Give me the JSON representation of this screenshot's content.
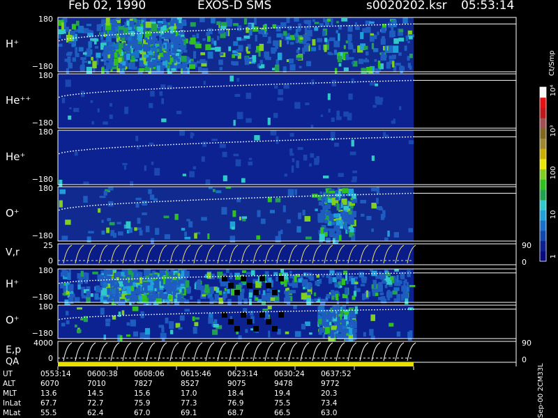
{
  "header": {
    "date": "Feb 02, 1990",
    "mission": "EXOS-D SMS",
    "file": "s0020202.ksr",
    "time": "05:53:14"
  },
  "colorbar": {
    "unit": "Ct/Smp",
    "tick_labels": [
      "1",
      "10",
      "100",
      "10³",
      "10⁴"
    ],
    "colors": [
      "#0a0a80",
      "#0c2090",
      "#1048b0",
      "#1870c8",
      "#20a0d8",
      "#30c8c8",
      "#20a050",
      "#30c020",
      "#80d020",
      "#e8e800",
      "#c8b000",
      "#a08830",
      "#806820",
      "#a05050",
      "#c01818",
      "#e81010",
      "#f8f8f8"
    ]
  },
  "footer": {
    "labels": [
      "UT",
      "ALT",
      "MLT",
      "InLat",
      "MLat"
    ],
    "columns": [
      {
        "UT": "0553:14",
        "ALT": "6070",
        "MLT": "13.6",
        "InLat": "67.7",
        "MLat": "55.5"
      },
      {
        "UT": "0600:38",
        "ALT": "7010",
        "MLT": "14.5",
        "InLat": "72.7",
        "MLat": "62.4"
      },
      {
        "UT": "0608:06",
        "ALT": "7827",
        "MLT": "15.6",
        "InLat": "75.9",
        "MLat": "67.0"
      },
      {
        "UT": "0615:46",
        "ALT": "8527",
        "MLT": "17.0",
        "InLat": "77.3",
        "MLat": "69.1"
      },
      {
        "UT": "0623:14",
        "ALT": "9075",
        "MLT": "18.4",
        "InLat": "76.9",
        "MLat": "68.7"
      },
      {
        "UT": "0630:24",
        "ALT": "9478",
        "MLT": "19.4",
        "InLat": "75.5",
        "MLat": "66.5"
      },
      {
        "UT": "0637:52",
        "ALT": "9772",
        "MLT": "20.3",
        "InLat": "73.4",
        "MLat": "63.0"
      }
    ],
    "side_note": "Sep-00  2CM33L"
  },
  "chart_data": {
    "type": "heatmap",
    "title": "Feb 02, 1990   EXOS-D SMS",
    "x_tick_labels": [
      "0553:14",
      "0600:38",
      "0608:06",
      "0615:46",
      "0623:14",
      "0630:24",
      "0637:52"
    ],
    "panels": [
      {
        "id": "h-plus-1",
        "label": "H⁺",
        "y_top": "180",
        "y_bottom": "−180",
        "background": "#102a90",
        "activity": "high"
      },
      {
        "id": "he-plus-plus",
        "label": "He⁺⁺",
        "y_top": "180",
        "y_bottom": "−180",
        "background": "#0c2290",
        "activity": "low"
      },
      {
        "id": "he-plus",
        "label": "He⁺",
        "y_top": "180",
        "y_bottom": "−180",
        "background": "#0c2290",
        "activity": "low"
      },
      {
        "id": "o-plus-1",
        "label": "O⁺",
        "y_top": "180",
        "y_bottom": "−180",
        "background": "#102a90",
        "activity": "medium"
      },
      {
        "id": "v-r",
        "label": "V,r",
        "y_top": "25",
        "y_bottom": "0",
        "right_labels": [
          "90",
          "0"
        ],
        "background": "#0a1c88",
        "trace_color": "#e8e070"
      },
      {
        "id": "h-plus-2",
        "label": "H⁺",
        "y_top": "180",
        "y_bottom": "−180",
        "background": "#0c2290",
        "activity": "high"
      },
      {
        "id": "o-plus-2",
        "label": "O⁺",
        "y_top": "180",
        "y_bottom": "−180",
        "background": "#0c2290",
        "activity": "medium"
      },
      {
        "id": "e-p",
        "label": "E,p",
        "y_top": "4000",
        "y_bottom": "0",
        "right_labels": [
          "90",
          "0"
        ],
        "background": "#000000",
        "trace_color": "#ffffff"
      },
      {
        "id": "qa",
        "label": "QA",
        "background": "#e8e000"
      }
    ]
  }
}
